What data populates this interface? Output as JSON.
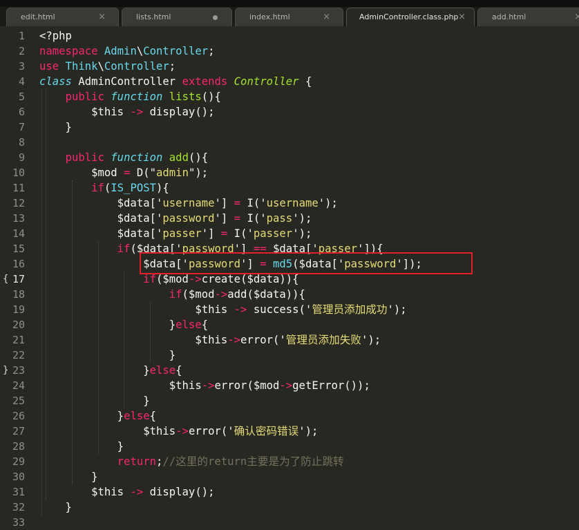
{
  "tabs": [
    {
      "label": "edit.html",
      "marker": "×"
    },
    {
      "label": "lists.html",
      "marker": "●"
    },
    {
      "label": "index.html",
      "marker": "×"
    },
    {
      "label": "AdminController.class.php",
      "marker": "×"
    },
    {
      "label": "add.html",
      "marker": "×"
    }
  ],
  "editor": {
    "line_numbers": [
      "1",
      "2",
      "3",
      "4",
      "5",
      "6",
      "7",
      "8",
      "9",
      "10",
      "11",
      "12",
      "13",
      "14",
      "15",
      "16",
      "17",
      "18",
      "19",
      "20",
      "21",
      "22",
      "23",
      "24",
      "25",
      "26",
      "27",
      "28",
      "29",
      "30",
      "31",
      "32",
      "33"
    ],
    "current_line": "17",
    "fold_markers": [
      "{",
      "}"
    ],
    "lines": [
      "<?php",
      "namespace Admin\\Controller;",
      "use Think\\Controller;",
      "class AdminController extends Controller {",
      "    public function lists(){",
      "        $this -> display();",
      "    }",
      "",
      "    public function add(){",
      "        $mod = D(\"admin\");",
      "        if(IS_POST){",
      "            $data['username'] = I('username');",
      "            $data['password'] = I('pass');",
      "            $data['passer'] = I('passer');",
      "            if($data['password'] == $data['passer']){",
      "                $data['password'] = md5($data['password']);",
      "                if($mod->create($data)){",
      "                    if($mod->add($data)){",
      "                        $this -> success('管理员添加成功');",
      "                    }else{",
      "                        $this->error('管理员添加失败');",
      "                    }",
      "                }else{",
      "                    $this->error($mod->getError());",
      "                }",
      "            }else{",
      "                $this->error('确认密码错误');",
      "            }",
      "            return;//这里的return主要是为了防止跳转",
      "        }",
      "        $this -> display();",
      "    }",
      ""
    ]
  },
  "annotation": {
    "color": "#e6202a",
    "target_line": "16"
  }
}
